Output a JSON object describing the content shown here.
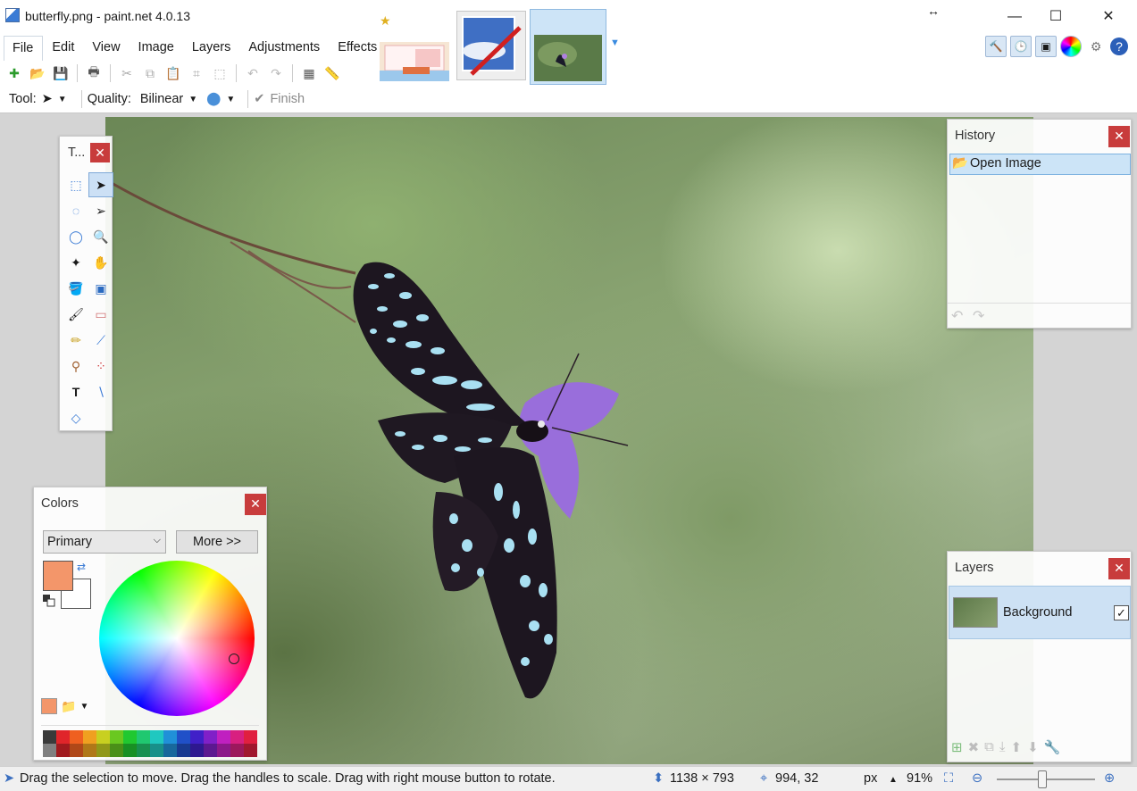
{
  "window": {
    "title": "butterfly.png - paint.net 4.0.13",
    "minimize_icon": "—",
    "maximize_icon": "☐",
    "close_icon": "✕"
  },
  "menu": [
    "File",
    "Edit",
    "View",
    "Image",
    "Layers",
    "Adjustments",
    "Effects"
  ],
  "options_bar": {
    "tool_label": "Tool:",
    "quality_label": "Quality:",
    "quality_value": "Bilinear",
    "finish_label": "Finish"
  },
  "tools_panel": {
    "title": "T..."
  },
  "history_panel": {
    "title": "History",
    "items": [
      "Open Image"
    ]
  },
  "layers_panel": {
    "title": "Layers",
    "layers": [
      {
        "name": "Background",
        "visible": true
      }
    ]
  },
  "colors_panel": {
    "title": "Colors",
    "selector_value": "Primary",
    "more_label": "More >>",
    "primary_color": "#f3966a",
    "secondary_color": "#ffffff",
    "palette": [
      "#3a3a3a",
      "#e0252a",
      "#ef6020",
      "#f0a020",
      "#c8d020",
      "#6ac820",
      "#20c830",
      "#20c870",
      "#20c8c0",
      "#2090d8",
      "#2050c8",
      "#4020c8",
      "#8020c8",
      "#c020c0",
      "#d82080",
      "#e02040",
      "#808080",
      "#a01a1e",
      "#b04818",
      "#b07818",
      "#909818",
      "#4a9018",
      "#189024",
      "#189050",
      "#18908a",
      "#18689c",
      "#183a90",
      "#2e1890",
      "#5c1890",
      "#8c188a",
      "#9c185c",
      "#a0182e"
    ]
  },
  "status": {
    "hint": "Drag the selection to move. Drag the handles to scale. Drag with right mouse button to rotate.",
    "image_size": "1138 × 793",
    "cursor_position": "994, 32",
    "units": "px",
    "zoom": "91%"
  }
}
